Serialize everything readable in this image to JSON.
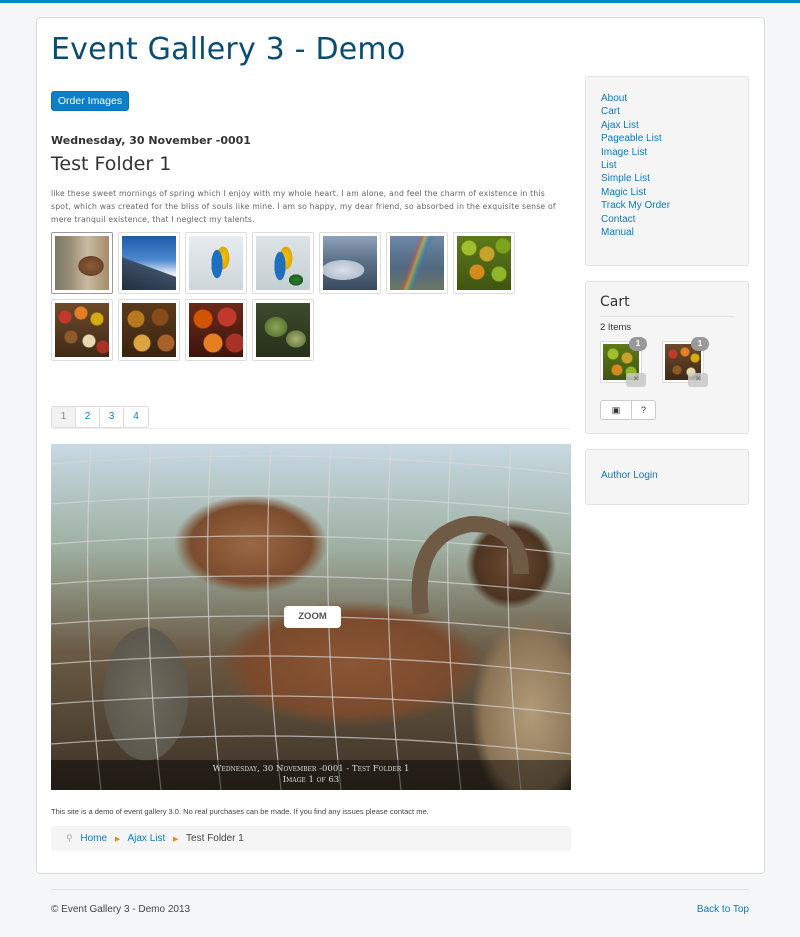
{
  "site": {
    "title": "Event Gallery 3 - Demo",
    "accent_color": "#0088cc"
  },
  "actions": {
    "order_images": "Order Images"
  },
  "event": {
    "date": "Wednesday, 30 November -0001",
    "title": "Test Folder 1",
    "description": "like these sweet mornings of spring which I enjoy with my whole heart. I am alone, and feel the charm of existence in this spot, which was created for the bliss of souls like mine. I am so happy, my dear friend, so absorbed in the exquisite sense of mere tranquil existence, that I neglect my talents."
  },
  "thumbnails": [
    {
      "subject": "goat",
      "selected": true
    },
    {
      "subject": "airplane-wing-over-clouds"
    },
    {
      "subject": "parrot"
    },
    {
      "subject": "parrot"
    },
    {
      "subject": "cloudy-mountains"
    },
    {
      "subject": "rainbow"
    },
    {
      "subject": "green-oranges"
    },
    {
      "subject": "spice-market"
    },
    {
      "subject": "spices-and-nuts"
    },
    {
      "subject": "pomegranates"
    },
    {
      "subject": "artichokes"
    }
  ],
  "pagination": {
    "pages": [
      "1",
      "2",
      "3",
      "4"
    ],
    "active": "1"
  },
  "viewer": {
    "zoom_label": "ZOOM",
    "caption_line1": "Wednesday, 30 November -0001 - Test Folder 1",
    "caption_line2": "Image 1 of 63"
  },
  "footnote": "This site is a demo of event gallery 3.0. No real purchases can be made. If you find any issues please contact me.",
  "breadcrumb": {
    "home": "Home",
    "list": "Ajax List",
    "current": "Test Folder 1"
  },
  "menu": {
    "items": [
      "About",
      "Cart",
      "Ajax List",
      "Pageable List",
      "Image List",
      "List",
      "Simple List",
      "Magic List",
      "Track My Order",
      "Contact",
      "Manual"
    ]
  },
  "cart": {
    "title": "Cart",
    "count_label": "2 Items",
    "items": [
      {
        "subject": "green-oranges",
        "quantity": "1"
      },
      {
        "subject": "spice-market",
        "quantity": "1"
      }
    ],
    "help_label": "?"
  },
  "login": {
    "link": "Author Login"
  },
  "footer": {
    "copyright": "© Event Gallery 3 - Demo 2013",
    "back_to_top": "Back to Top"
  }
}
